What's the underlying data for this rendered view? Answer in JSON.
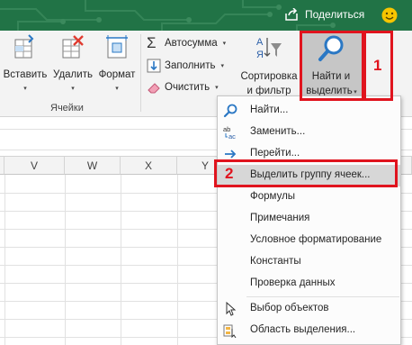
{
  "titlebar": {
    "share_label": "Поделиться",
    "accent": "#217346"
  },
  "ribbon": {
    "insert": {
      "label": "Вставить"
    },
    "delete": {
      "label": "Удалить"
    },
    "format": {
      "label": "Формат"
    },
    "cells_group_label": "Ячейки",
    "autosum_label": "Автосумма",
    "fill_label": "Заполнить",
    "clear_label": "Очистить",
    "sort": {
      "line1": "Сортировка",
      "line2": "и фильтр"
    },
    "find": {
      "line1": "Найти и",
      "line2": "выделить"
    }
  },
  "columns": [
    "V",
    "W",
    "X",
    "Y"
  ],
  "annotations": {
    "step1": "1",
    "step2": "2",
    "highlight_color": "#e0141e"
  },
  "menu": {
    "items": [
      {
        "label": "Найти...",
        "icon": "magnifier-icon"
      },
      {
        "label": "Заменить...",
        "icon": "replace-ab-ac-icon"
      },
      {
        "label": "Перейти...",
        "icon": "arrow-right-icon"
      },
      {
        "label": "Выделить группу ячеек...",
        "icon": "none",
        "highlighted": true
      },
      {
        "label": "Формулы"
      },
      {
        "label": "Примечания"
      },
      {
        "label": "Условное форматирование"
      },
      {
        "label": "Константы"
      },
      {
        "label": "Проверка данных"
      },
      {
        "label": "Выбор объектов",
        "icon": "cursor-arrow-icon"
      },
      {
        "label": "Область выделения...",
        "icon": "selection-pane-icon"
      }
    ]
  }
}
